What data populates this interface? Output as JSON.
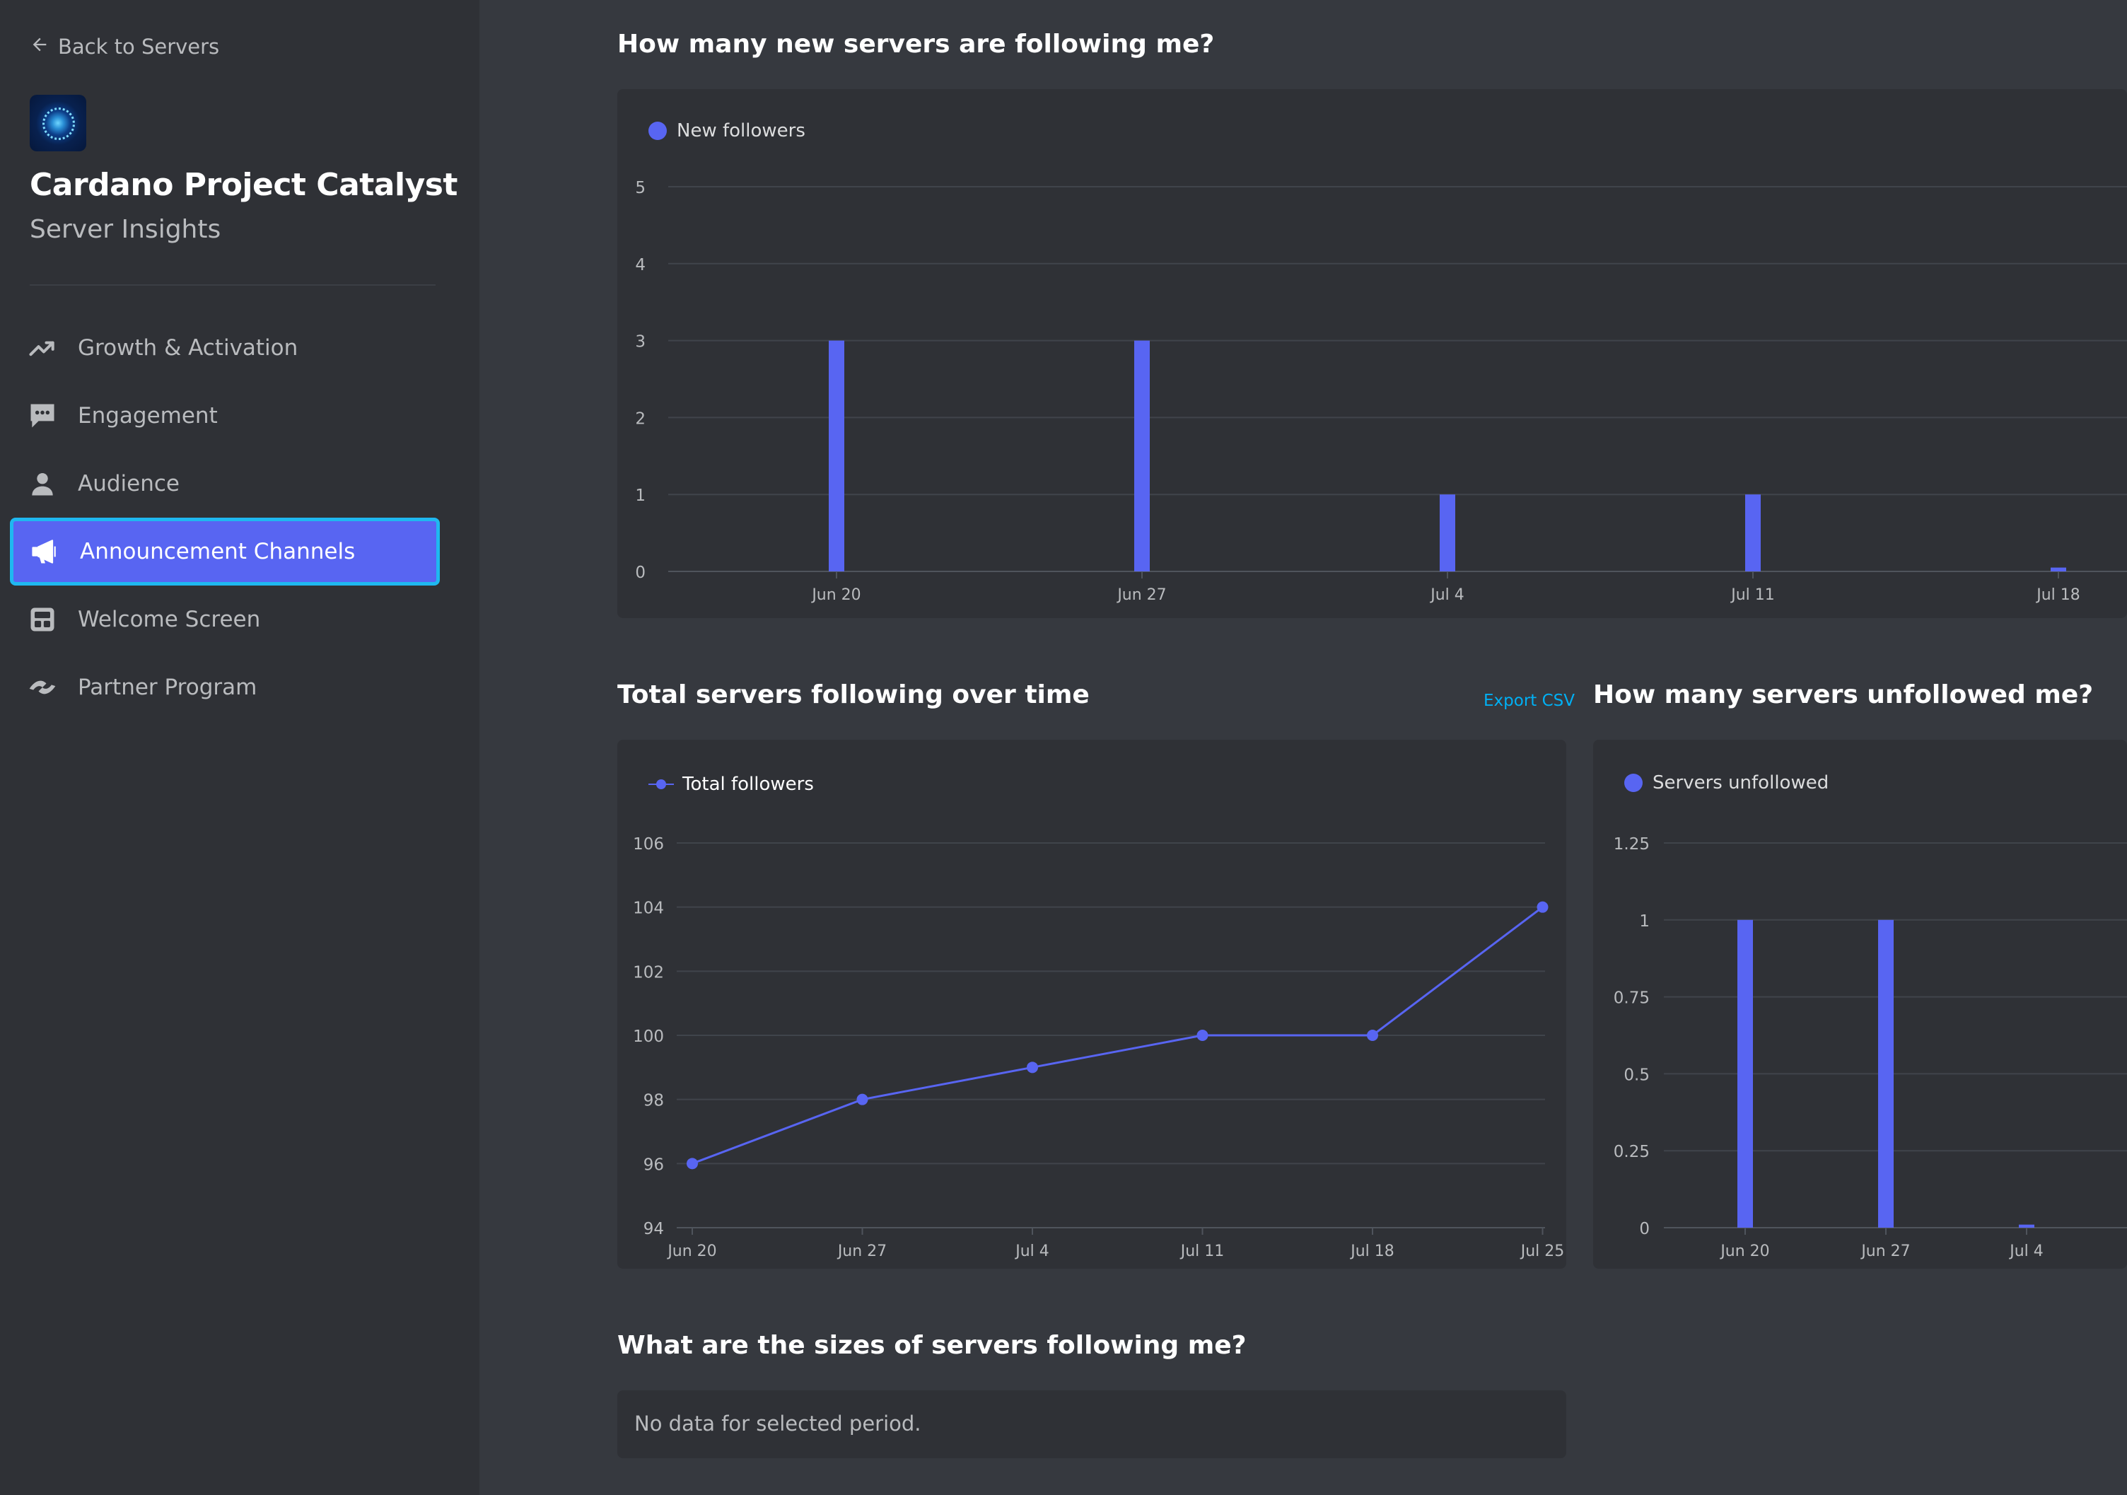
{
  "sidebar": {
    "back_label": "Back to Servers",
    "server_name": "Cardano Project Catalyst",
    "server_subtitle": "Server Insights",
    "items": [
      {
        "label": "Growth & Activation",
        "icon": "trending-up-icon",
        "active": false
      },
      {
        "label": "Engagement",
        "icon": "chat-bubble-icon",
        "active": false
      },
      {
        "label": "Audience",
        "icon": "person-icon",
        "active": false
      },
      {
        "label": "Announcement Channels",
        "icon": "megaphone-icon",
        "active": true
      },
      {
        "label": "Welcome Screen",
        "icon": "welcome-icon",
        "active": false
      },
      {
        "label": "Partner Program",
        "icon": "partner-icon",
        "active": false
      }
    ]
  },
  "sections": {
    "new_followers_title": "How many new servers are following me?",
    "total_following_title": "Total servers following over time",
    "export_label": "Export CSV",
    "unfollowed_title": "How many servers unfollowed me?",
    "sizes_title": "What are the sizes of servers following me?",
    "no_data": "No data for selected period."
  },
  "colors": {
    "accent": "#5865f2",
    "background": "#36393f",
    "sidebar": "#2f3136",
    "card": "#2f3136",
    "link": "#00b0f4",
    "focus_ring": "#1fb8f0"
  },
  "chart_data": [
    {
      "id": "new_followers",
      "type": "bar",
      "legend": "New followers",
      "ylim": [
        0,
        5
      ],
      "yticks": [
        0,
        1,
        2,
        3,
        4,
        5
      ],
      "xticks": [
        "Jun 20",
        "Jun 27",
        "Jul 4",
        "Jul 11",
        "Jul 18"
      ],
      "categories": [
        "Jun 20",
        "Jun 27",
        "Jul 4",
        "Jul 11",
        "Jul 18"
      ],
      "values": [
        3,
        3,
        1,
        1,
        0.05
      ]
    },
    {
      "id": "total_followers",
      "type": "line",
      "legend": "Total followers",
      "ylim": [
        94,
        106
      ],
      "yticks": [
        94,
        96,
        98,
        100,
        102,
        104,
        106
      ],
      "xticks": [
        "Jun 20",
        "Jun 27",
        "Jul 4",
        "Jul 11",
        "Jul 18",
        "Jul 25"
      ],
      "x": [
        "Jun 20",
        "Jun 27",
        "Jul 4",
        "Jul 11",
        "Jul 18",
        "Jul 25"
      ],
      "values": [
        96,
        98,
        99,
        100,
        100,
        104
      ]
    },
    {
      "id": "servers_unfollowed",
      "type": "bar",
      "legend": "Servers unfollowed",
      "ylim": [
        0,
        1.25
      ],
      "yticks": [
        "0",
        "0.25",
        "0.5",
        "0.75",
        "1",
        "1.25"
      ],
      "xticks": [
        "Jun 20",
        "Jun 27",
        "Jul 4"
      ],
      "categories": [
        "Jun 20",
        "Jun 27",
        "Jul 4"
      ],
      "values": [
        1,
        1,
        0.01
      ]
    }
  ]
}
